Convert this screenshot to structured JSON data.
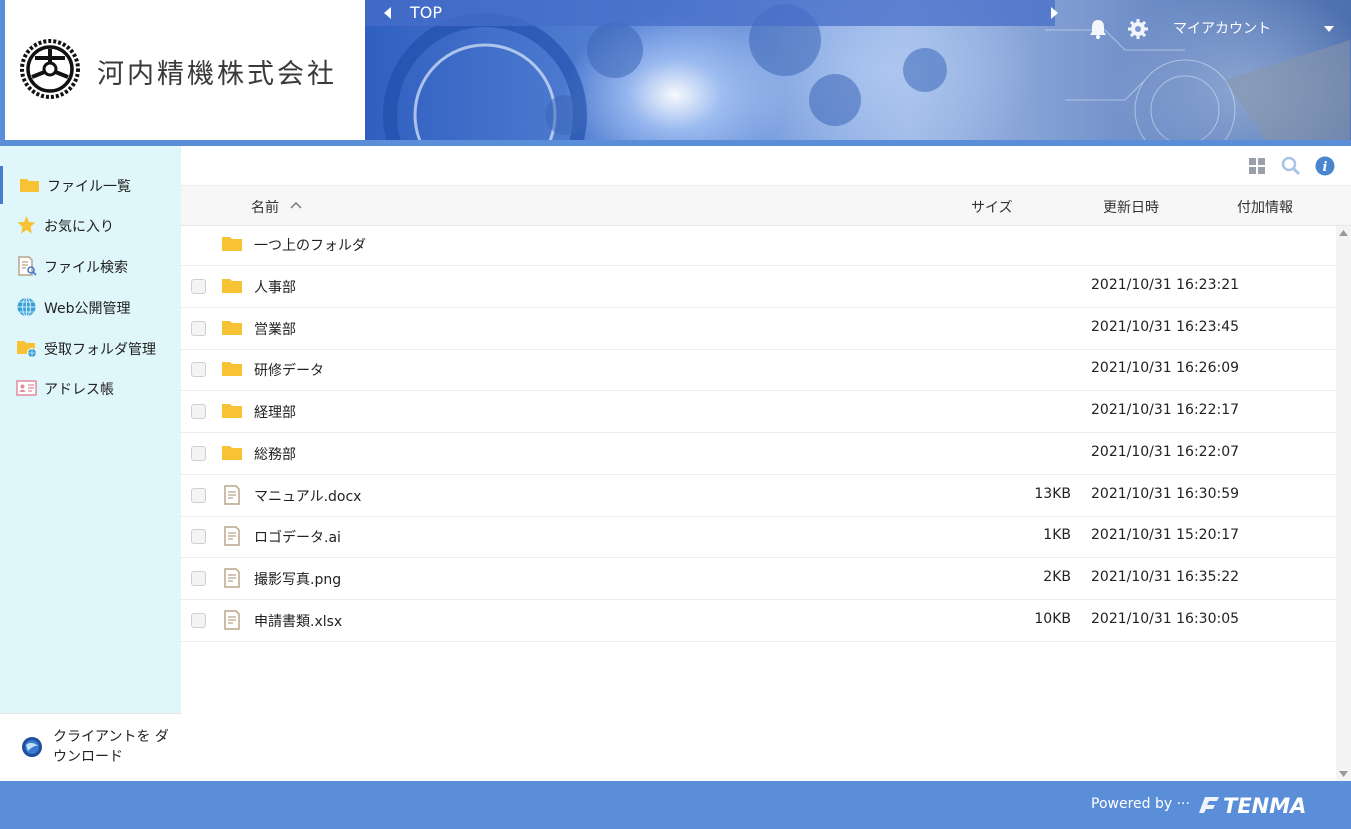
{
  "header": {
    "company_name": "河内精機株式会社",
    "breadcrumb": "TOP",
    "account_label": "マイアカウント",
    "colors": {
      "header_bar": "#5b8ed8",
      "sidebar_bg": "#dff6fa",
      "folder": "#f7c233"
    }
  },
  "sidebar": {
    "items": [
      {
        "label": "ファイル一覧",
        "icon": "folder-icon"
      },
      {
        "label": "お気に入り",
        "icon": "star-icon"
      },
      {
        "label": "ファイル検索",
        "icon": "file-search-icon"
      },
      {
        "label": "Web公開管理",
        "icon": "globe-icon"
      },
      {
        "label": "受取フォルダ管理",
        "icon": "folder-globe-icon"
      },
      {
        "label": "アドレス帳",
        "icon": "address-book-icon"
      }
    ],
    "client_download": "クライアントを ダウンロード"
  },
  "toolbar": {
    "icons": [
      "grid-view-icon",
      "search-icon",
      "info-icon"
    ]
  },
  "table": {
    "columns": {
      "name": "名前",
      "size": "サイズ",
      "modified": "更新日時",
      "extra": "付加情報"
    },
    "parent_folder": "一つ上のフォルダ",
    "rows": [
      {
        "type": "folder",
        "name": "人事部",
        "size": "",
        "date": "2021/10/31 16:23:21"
      },
      {
        "type": "folder",
        "name": "営業部",
        "size": "",
        "date": "2021/10/31 16:23:45"
      },
      {
        "type": "folder",
        "name": "研修データ",
        "size": "",
        "date": "2021/10/31 16:26:09"
      },
      {
        "type": "folder",
        "name": "経理部",
        "size": "",
        "date": "2021/10/31 16:22:17"
      },
      {
        "type": "folder",
        "name": "総務部",
        "size": "",
        "date": "2021/10/31 16:22:07"
      },
      {
        "type": "file",
        "name": "マニュアル.docx",
        "size": "13KB",
        "date": "2021/10/31 16:30:59"
      },
      {
        "type": "file",
        "name": "ロゴデータ.ai",
        "size": "1KB",
        "date": "2021/10/31 15:20:17"
      },
      {
        "type": "file",
        "name": "撮影写真.png",
        "size": "2KB",
        "date": "2021/10/31 16:35:22"
      },
      {
        "type": "file",
        "name": "申請書類.xlsx",
        "size": "10KB",
        "date": "2021/10/31 16:30:05"
      }
    ]
  },
  "footer": {
    "powered_by": "Powered by ···",
    "brand": "TENMA"
  }
}
